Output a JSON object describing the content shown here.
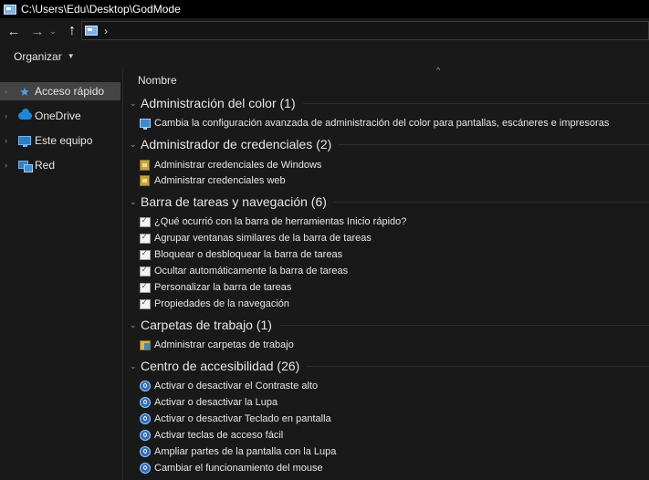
{
  "window": {
    "title": "C:\\Users\\Edu\\Desktop\\GodMode"
  },
  "nav": {
    "back_glyph": "←",
    "forward_glyph": "→",
    "history_glyph": "⌄",
    "up_glyph": "↑",
    "address_separator": "›"
  },
  "commandbar": {
    "organize_label": "Organizar",
    "organize_caret": "▼"
  },
  "sidebar": {
    "items": [
      {
        "label": "Acceso rápido",
        "icon": "star-icon",
        "chevron": "›"
      },
      {
        "label": "OneDrive",
        "icon": "cloud-icon",
        "chevron": "›"
      },
      {
        "label": "Este equipo",
        "icon": "computer-icon",
        "chevron": "›"
      },
      {
        "label": "Red",
        "icon": "network-icon",
        "chevron": "›"
      }
    ]
  },
  "content": {
    "column_header": "Nombre",
    "sort_glyph": "^",
    "groups": [
      {
        "title": "Administración del color (1)",
        "chevron": "⌄",
        "icon": "color-monitor-icon",
        "items": [
          "Cambia la configuración avanzada de administración del color para pantallas, escáneres e impresoras"
        ]
      },
      {
        "title": "Administrador de credenciales (2)",
        "chevron": "⌄",
        "icon": "credential-vault-icon",
        "items": [
          "Administrar credenciales de Windows",
          "Administrar credenciales web"
        ]
      },
      {
        "title": "Barra de tareas y navegación (6)",
        "chevron": "⌄",
        "icon": "taskbar-check-icon",
        "items": [
          "¿Qué ocurrió con la barra de herramientas Inicio rápido?",
          "Agrupar ventanas similares de la barra de tareas",
          "Bloquear o desbloquear la barra de tareas",
          "Ocultar automáticamente la barra de tareas",
          "Personalizar la barra de tareas",
          "Propiedades de la navegación"
        ]
      },
      {
        "title": "Carpetas de trabajo (1)",
        "chevron": "⌄",
        "icon": "work-folders-icon",
        "items": [
          "Administrar carpetas de trabajo"
        ]
      },
      {
        "title": "Centro de accesibilidad (26)",
        "chevron": "⌄",
        "icon": "accessibility-icon",
        "items": [
          "Activar o desactivar el Contraste alto",
          "Activar o desactivar la Lupa",
          "Activar o desactivar Teclado en pantalla",
          "Activar teclas de acceso fácil",
          "Ampliar partes de la pantalla con la Lupa",
          "Cambiar el funcionamiento del mouse"
        ]
      }
    ]
  },
  "colors": {
    "background": "#191919",
    "titlebar": "#000000",
    "selected_nav": "#444444",
    "text": "#e6e6e6",
    "accent": "#1a8ad8"
  }
}
